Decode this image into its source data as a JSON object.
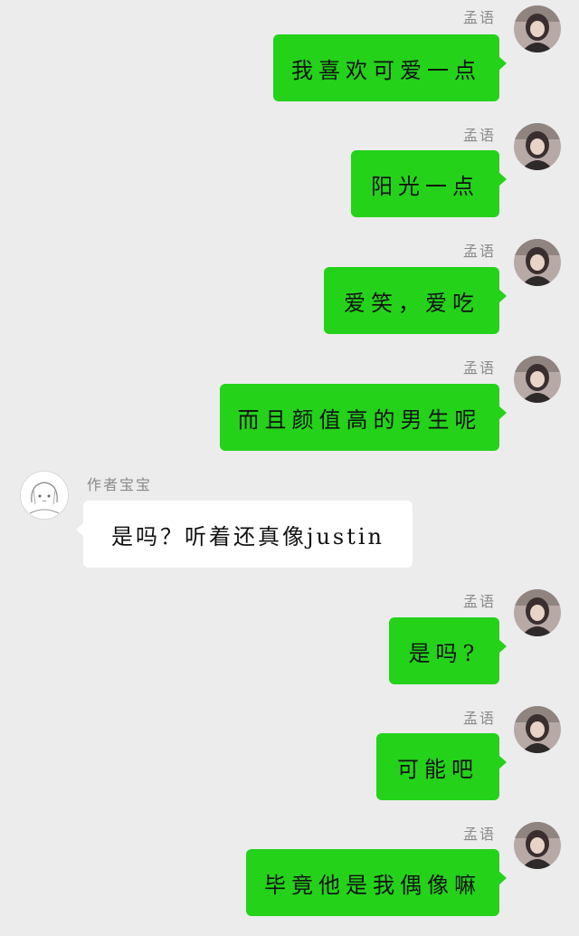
{
  "me": {
    "name": "孟语"
  },
  "friend": {
    "name": "作者宝宝"
  },
  "messages": [
    {
      "side": "right",
      "text": "我喜欢可爱一点"
    },
    {
      "side": "right",
      "text": "阳光一点"
    },
    {
      "side": "right",
      "text": "爱笑，爱吃"
    },
    {
      "side": "right",
      "text": "而且颜值高的男生呢"
    },
    {
      "side": "left",
      "text": "是吗？听着还真像justin"
    },
    {
      "side": "right",
      "text": "是吗?"
    },
    {
      "side": "right",
      "text": "可能吧"
    },
    {
      "side": "right",
      "text": "毕竟他是我偶像嘛"
    }
  ],
  "colors": {
    "sent_bubble": "#24d21a",
    "received_bubble": "#ffffff",
    "background": "#ececed"
  },
  "icons": {
    "me_avatar": "photo-avatar",
    "friend_avatar": "anime-sketch-avatar"
  }
}
